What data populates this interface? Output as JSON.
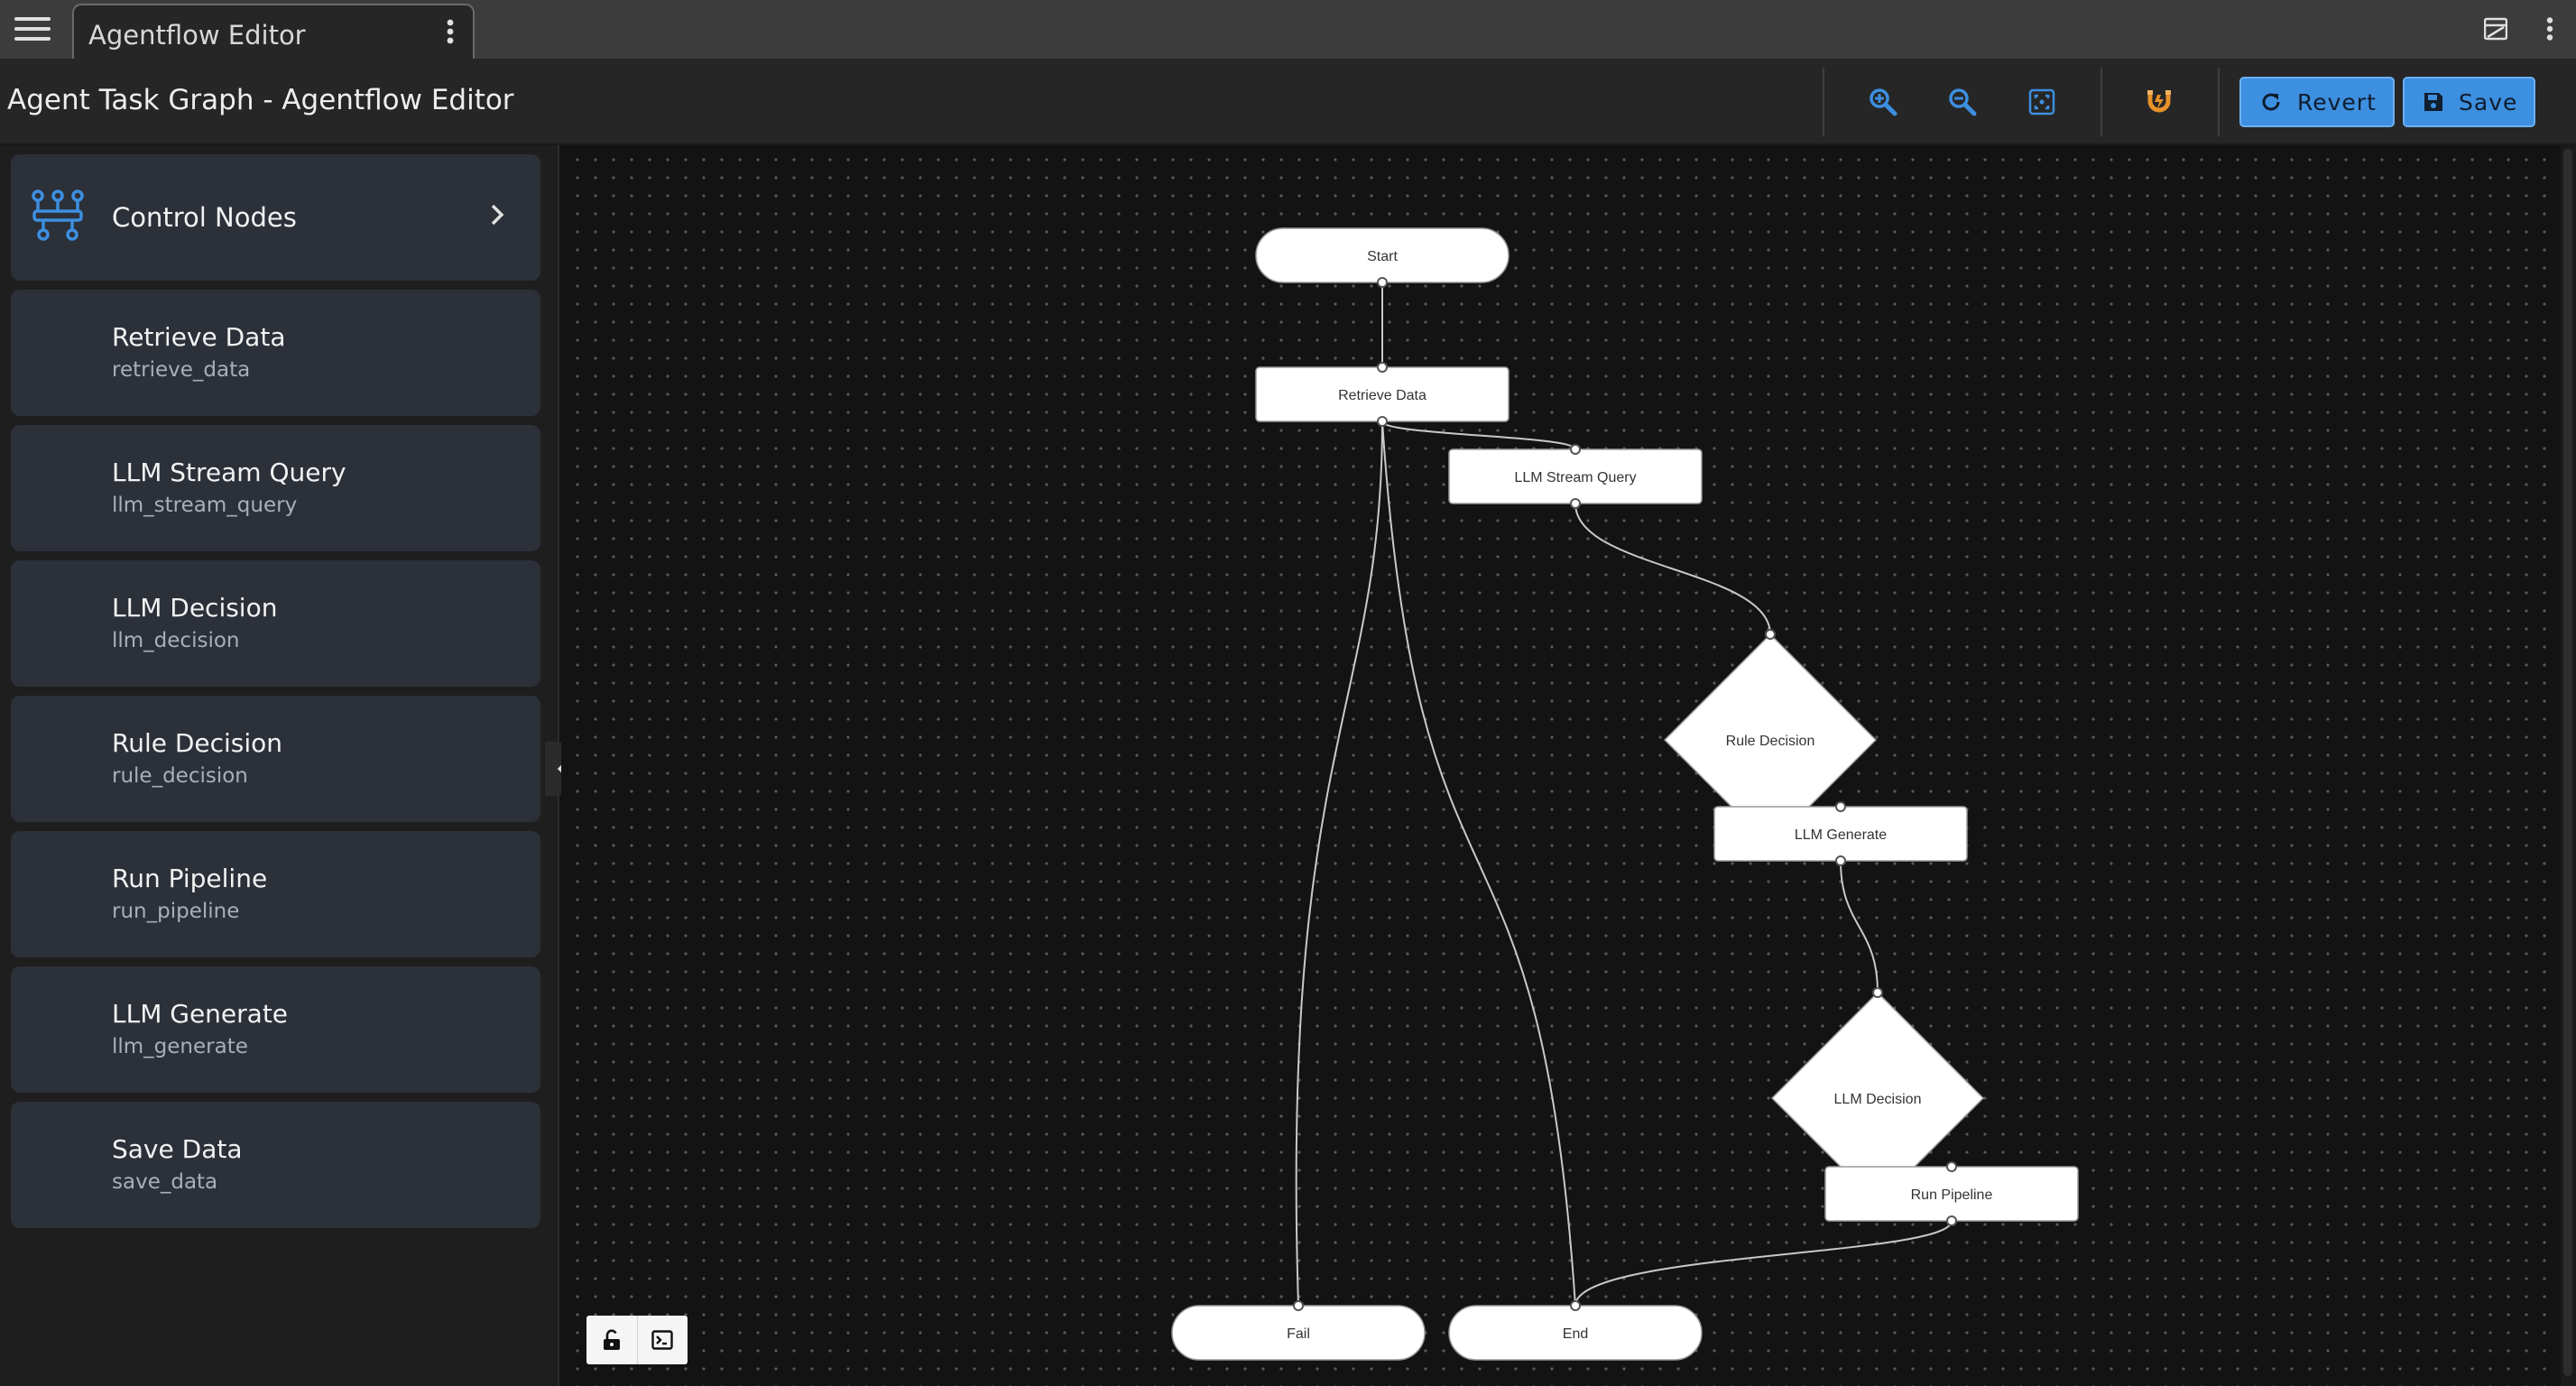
{
  "tab": {
    "label": "Agentflow Editor"
  },
  "header": {
    "title": "Agent Task Graph - Agentflow Editor",
    "revert_label": "Revert",
    "save_label": "Save"
  },
  "colors": {
    "accent": "#3d8fe0",
    "magnet": "#e8902a",
    "canvas": "#131313",
    "node_fill": "#ffffff"
  },
  "sidebar": {
    "control": {
      "label": "Control Nodes",
      "icon": "workflow-icon"
    },
    "items": [
      {
        "title": "Retrieve Data",
        "subtitle": "retrieve_data"
      },
      {
        "title": "LLM Stream Query",
        "subtitle": "llm_stream_query"
      },
      {
        "title": "LLM Decision",
        "subtitle": "llm_decision"
      },
      {
        "title": "Rule Decision",
        "subtitle": "rule_decision"
      },
      {
        "title": "Run Pipeline",
        "subtitle": "run_pipeline"
      },
      {
        "title": "LLM Generate",
        "subtitle": "llm_generate"
      },
      {
        "title": "Save Data",
        "subtitle": "save_data"
      }
    ]
  },
  "graph": {
    "nodes": [
      {
        "id": "start",
        "label": "Start",
        "shape": "terminal"
      },
      {
        "id": "retrieve",
        "label": "Retrieve Data",
        "shape": "process"
      },
      {
        "id": "stream",
        "label": "LLM Stream Query",
        "shape": "process"
      },
      {
        "id": "rule",
        "label": "Rule Decision",
        "shape": "decision"
      },
      {
        "id": "generate",
        "label": "LLM Generate",
        "shape": "process"
      },
      {
        "id": "decision",
        "label": "LLM Decision",
        "shape": "decision"
      },
      {
        "id": "pipeline",
        "label": "Run Pipeline",
        "shape": "process"
      },
      {
        "id": "fail",
        "label": "Fail",
        "shape": "terminal"
      },
      {
        "id": "end",
        "label": "End",
        "shape": "terminal"
      }
    ],
    "edges": [
      {
        "from": "start",
        "to": "retrieve"
      },
      {
        "from": "retrieve",
        "to": "stream"
      },
      {
        "from": "stream",
        "to": "rule"
      },
      {
        "from": "rule",
        "to": "generate"
      },
      {
        "from": "generate",
        "to": "decision"
      },
      {
        "from": "decision",
        "to": "pipeline"
      },
      {
        "from": "pipeline",
        "to": "end"
      },
      {
        "from": "retrieve",
        "to": "fail"
      },
      {
        "from": "retrieve",
        "to": "end"
      }
    ]
  }
}
